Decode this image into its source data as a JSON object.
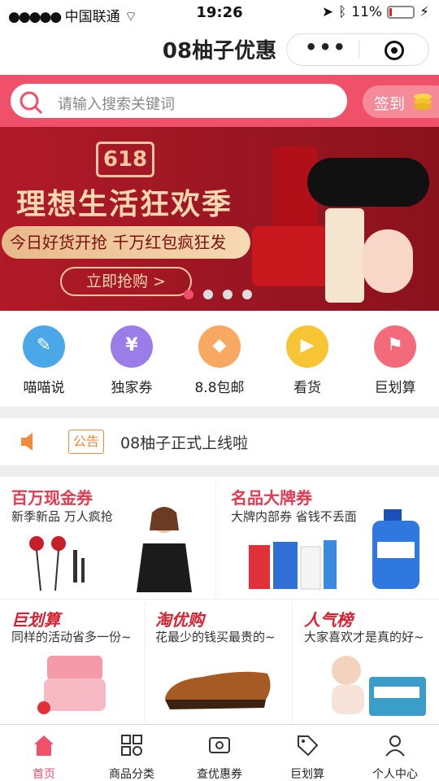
{
  "status_bar": {
    "carrier": "中国联通",
    "time": "19:26",
    "battery": "11%",
    "battery_level": 0.11
  },
  "navbar": {
    "title": "08柚子优惠",
    "more_icon": "more-dots-icon",
    "close_icon": "target-close-icon"
  },
  "search": {
    "placeholder": "请输入搜索关键词",
    "signin_label": "签到"
  },
  "banner": {
    "logo": "618",
    "headline": "理想生活狂欢季",
    "subline": "今日好货开抢 千万红包疯狂发",
    "cta": "立即抢购 >",
    "slide_count": 4,
    "active_slide": 1
  },
  "quick_nav": [
    {
      "label": "喵喵说",
      "icon": "chat-bubble-icon",
      "color": "#4aa8e8",
      "symbol": "✎"
    },
    {
      "label": "独家券",
      "icon": "coupon-icon",
      "color": "#9a7de8",
      "symbol": "¥"
    },
    {
      "label": "8.8包邮",
      "icon": "diamond-icon",
      "color": "#f8a860",
      "symbol": "◆"
    },
    {
      "label": "看货",
      "icon": "video-camera-icon",
      "color": "#f7c533",
      "symbol": "▶"
    },
    {
      "label": "巨划算",
      "icon": "flag-icon",
      "color": "#f36b7a",
      "symbol": "⚑"
    }
  ],
  "notice": {
    "badge": "公告",
    "text": "08柚子正式上线啦"
  },
  "promos": {
    "p1": {
      "title": "百万现金券",
      "subtitle": "新季新品 万人疯抢",
      "color": "#e8384f"
    },
    "p2": {
      "title": "名品大牌券",
      "subtitle": "大牌内部券 省钱不丢面",
      "color": "#e8384f"
    },
    "p3": {
      "title": "巨划算",
      "subtitle": "同样的活动省多一份~",
      "color": "#d92030"
    },
    "p4": {
      "title": "淘优购",
      "subtitle": "花最少的钱买最贵的~",
      "color": "#d92030"
    },
    "p5": {
      "title": "人气榜",
      "subtitle": "大家喜欢才是真的好~",
      "color": "#d92030"
    }
  },
  "tabbar": [
    {
      "label": "首页",
      "icon": "home-icon",
      "active": true
    },
    {
      "label": "商品分类",
      "icon": "category-grid-icon",
      "active": false
    },
    {
      "label": "查优惠券",
      "icon": "coupon-search-icon",
      "active": false
    },
    {
      "label": "巨划算",
      "icon": "deal-tag-icon",
      "active": false
    },
    {
      "label": "个人中心",
      "icon": "person-icon",
      "active": false
    }
  ]
}
